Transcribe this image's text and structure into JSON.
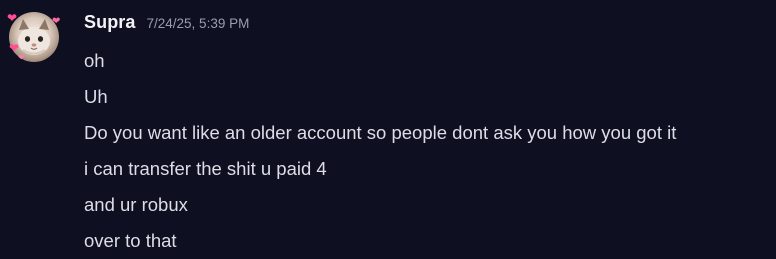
{
  "message": {
    "author": "Supra",
    "timestamp": "7/24/25, 5:39 PM",
    "avatar_icon": "cat-avatar-with-hearts",
    "lines": [
      "oh",
      "Uh",
      "Do you want like an older account so people dont ask you how you got it",
      "i can transfer the shit u paid 4",
      "and ur robux",
      "over to that"
    ]
  },
  "colors": {
    "background": "#0f0f22",
    "username": "#f2f3f5",
    "timestamp": "#9b9cae",
    "text": "#dcdde6",
    "heart": "#ff4f91"
  }
}
